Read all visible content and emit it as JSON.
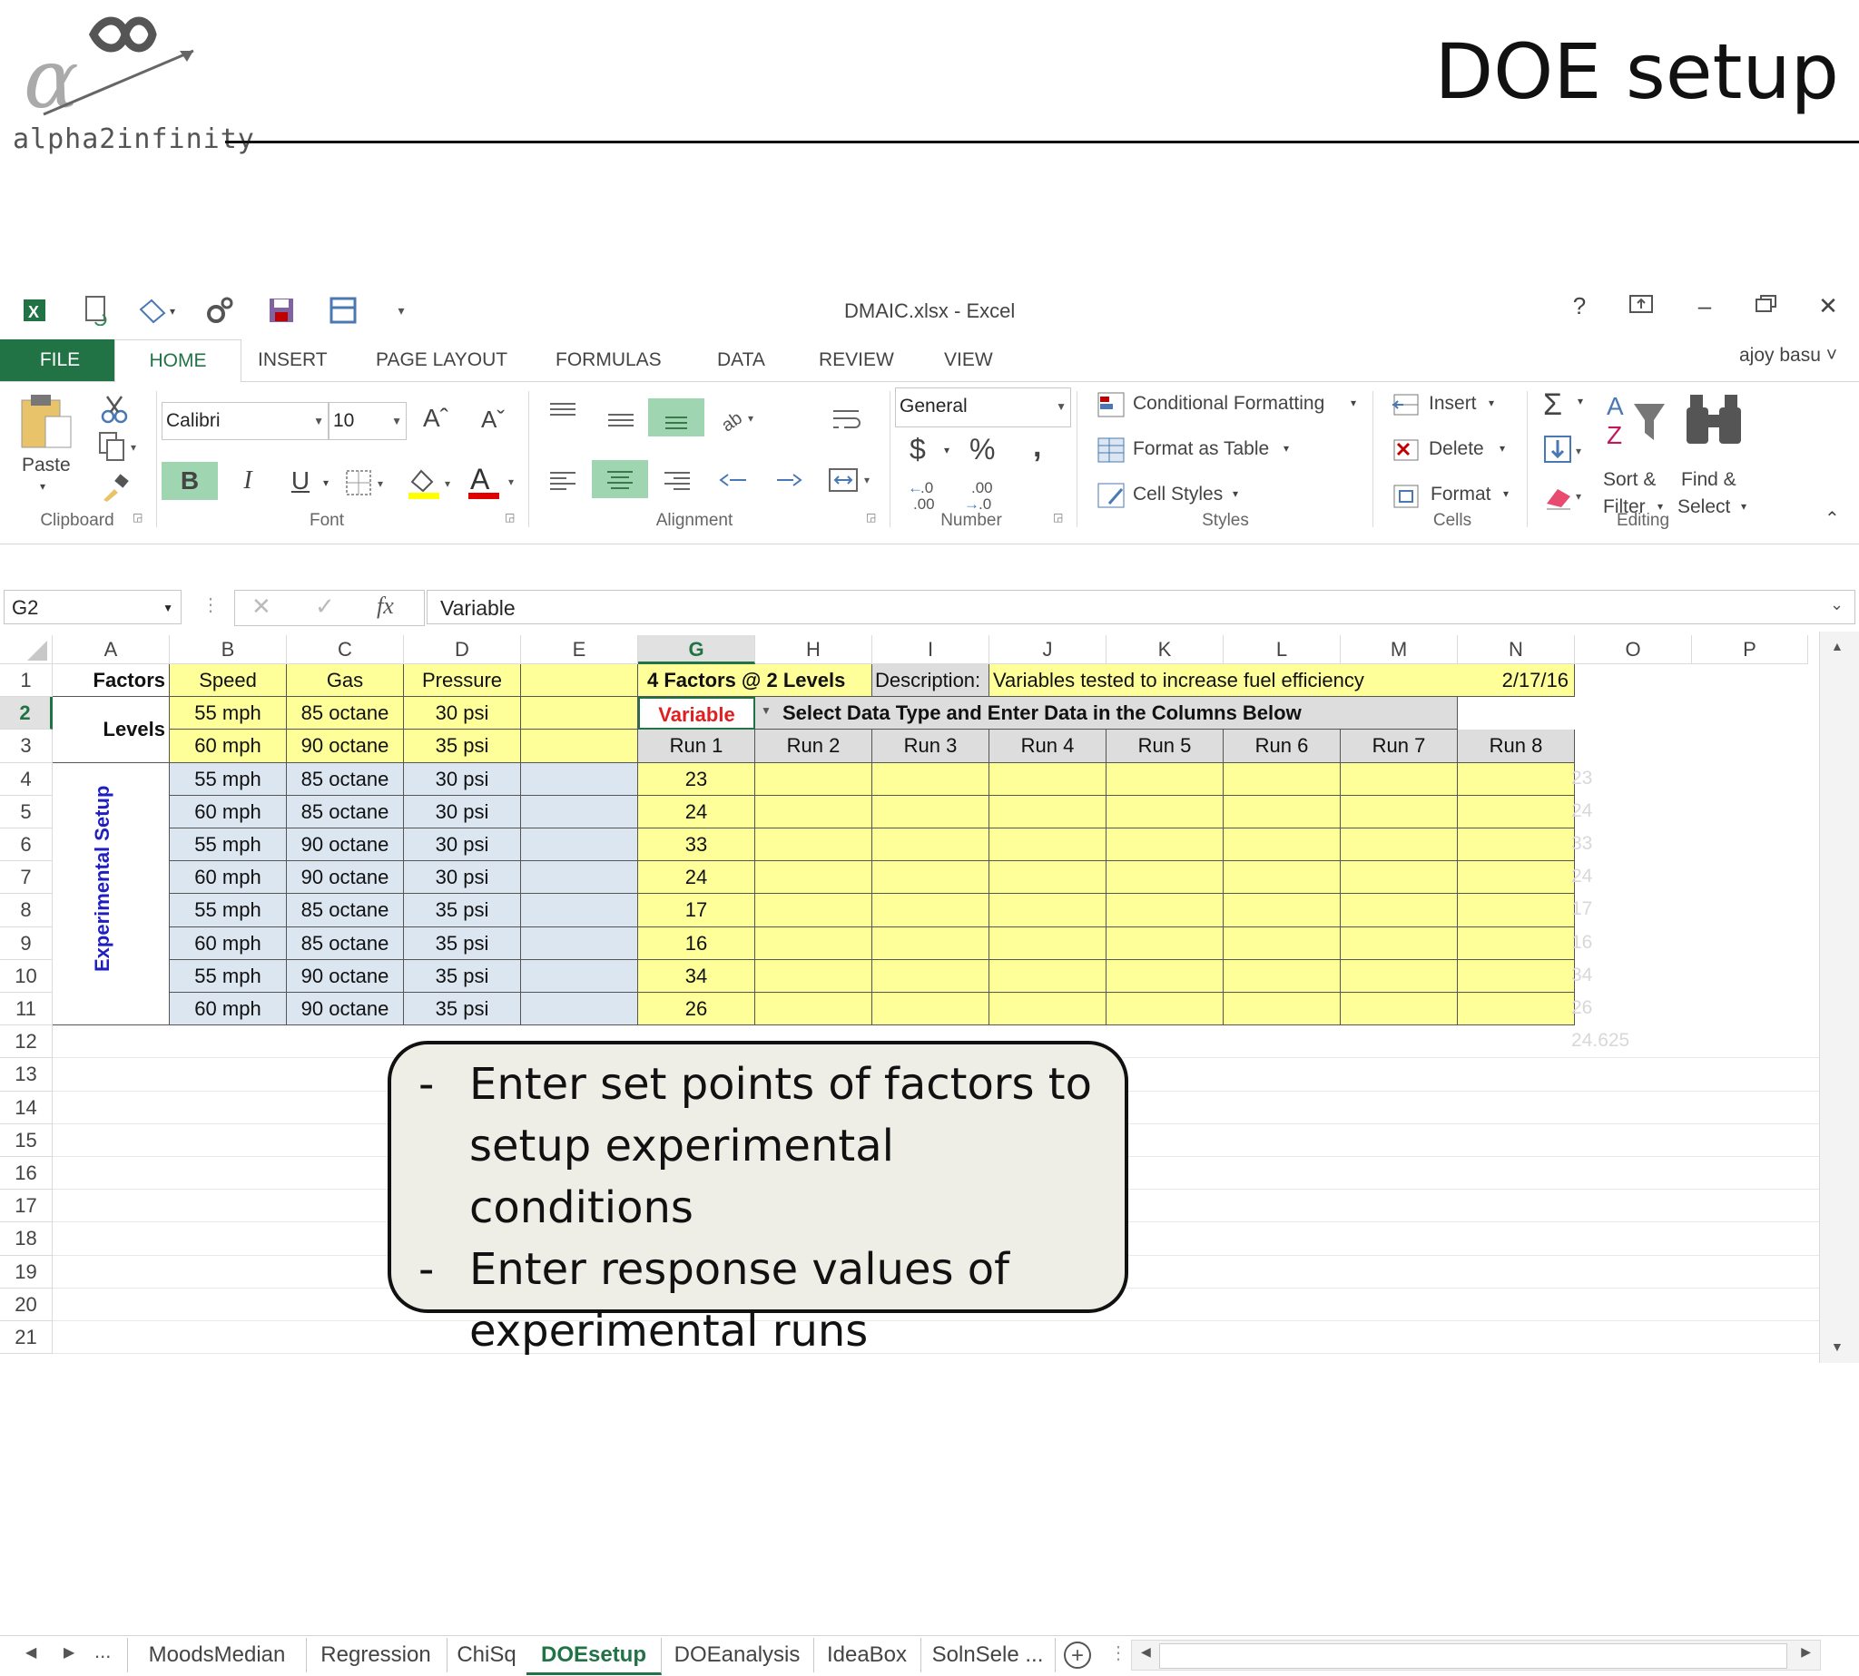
{
  "slide": {
    "title": "DOE setup",
    "logo_text": "alpha2infinity"
  },
  "window": {
    "title": "DMAIC.xlsx - Excel",
    "help": "?",
    "minimize": "–",
    "close": "✕"
  },
  "tabs": [
    "FILE",
    "HOME",
    "INSERT",
    "PAGE LAYOUT",
    "FORMULAS",
    "DATA",
    "REVIEW",
    "VIEW"
  ],
  "user": "ajoy basu ˅",
  "ribbon": {
    "clipboard": {
      "paste": "Paste",
      "label": "Clipboard"
    },
    "font": {
      "name": "Calibri",
      "size": "10",
      "bold": "B",
      "italic": "I",
      "underline": "U",
      "label": "Font"
    },
    "alignment": {
      "label": "Alignment"
    },
    "number": {
      "format": "General",
      "currency": "$",
      "percent": "%",
      "comma": ",",
      "inc_decimal": "←.0\n.00",
      "dec_decimal": ".00\n→.0",
      "label": "Number"
    },
    "styles": {
      "conditional": "Conditional Formatting",
      "format_table": "Format as Table",
      "cell_styles": "Cell Styles",
      "label": "Styles"
    },
    "cells": {
      "insert": "Insert",
      "delete": "Delete",
      "format": "Format",
      "label": "Cells"
    },
    "editing": {
      "sum": "Σ",
      "sort_1": "Sort &",
      "sort_2": "Filter",
      "find_1": "Find &",
      "find_2": "Select",
      "label": "Editing"
    }
  },
  "formula_bar": {
    "name_box": "G2",
    "fx": "fx",
    "formula": "Variable"
  },
  "columns": [
    "A",
    "B",
    "C",
    "D",
    "E",
    "G",
    "H",
    "I",
    "J",
    "K",
    "L",
    "M",
    "N",
    "O",
    "P"
  ],
  "rows": [
    "1",
    "2",
    "3",
    "4",
    "5",
    "6",
    "7",
    "8",
    "9",
    "10",
    "11",
    "12",
    "13",
    "14",
    "15",
    "16",
    "17",
    "18",
    "19",
    "20",
    "21"
  ],
  "sheet": {
    "r1": {
      "A": "Factors",
      "B": "Speed",
      "C": "Gas",
      "D": "Pressure",
      "G": "4 Factors @ 2 Levels",
      "I": "Description:",
      "J": "Variables tested to increase fuel efficiency",
      "N": "2/17/16"
    },
    "levels_label": "Levels",
    "r2": {
      "B": "55 mph",
      "C": "85 octane",
      "D": "30 psi",
      "G": "Variable",
      "H": "Select Data Type and Enter Data in the Columns Below"
    },
    "r3": {
      "B": "60 mph",
      "C": "90 octane",
      "D": "35 psi"
    },
    "runs": [
      "Run 1",
      "Run 2",
      "Run 3",
      "Run 4",
      "Run 5",
      "Run 6",
      "Run 7",
      "Run 8"
    ],
    "exp_label": "Experimental Setup",
    "exp_rows": [
      {
        "B": "55 mph",
        "C": "85 octane",
        "D": "30 psi",
        "G": "23"
      },
      {
        "B": "60 mph",
        "C": "85 octane",
        "D": "30 psi",
        "G": "24"
      },
      {
        "B": "55 mph",
        "C": "90 octane",
        "D": "30 psi",
        "G": "33"
      },
      {
        "B": "60 mph",
        "C": "90 octane",
        "D": "30 psi",
        "G": "24"
      },
      {
        "B": "55 mph",
        "C": "85 octane",
        "D": "35 psi",
        "G": "17"
      },
      {
        "B": "60 mph",
        "C": "85 octane",
        "D": "35 psi",
        "G": "16"
      },
      {
        "B": "55 mph",
        "C": "90 octane",
        "D": "35 psi",
        "G": "34"
      },
      {
        "B": "60 mph",
        "C": "90 octane",
        "D": "35 psi",
        "G": "26"
      }
    ],
    "ghost_values": [
      "23",
      "24",
      "33",
      "24",
      "17",
      "16",
      "34",
      "26",
      "24.625"
    ]
  },
  "callout": {
    "bullets": [
      {
        "dash": "-",
        "text": "Enter set points of factors to setup experimental conditions"
      },
      {
        "dash": "-",
        "text": "Enter response values of experimental runs"
      }
    ]
  },
  "sheet_tabs": {
    "more_left": "...",
    "tabs": [
      "MoodsMedian",
      "Regression",
      "ChiSq",
      "DOEsetup",
      "DOEanalysis",
      "IdeaBox",
      "SolnSele ..."
    ],
    "active": "DOEsetup",
    "add": "+"
  },
  "colors": {
    "excel_green": "#217346",
    "yellow": "#ffff99",
    "blue": "#dce6f1",
    "red_text": "#e02020",
    "navy_text": "#1f1fbf"
  }
}
